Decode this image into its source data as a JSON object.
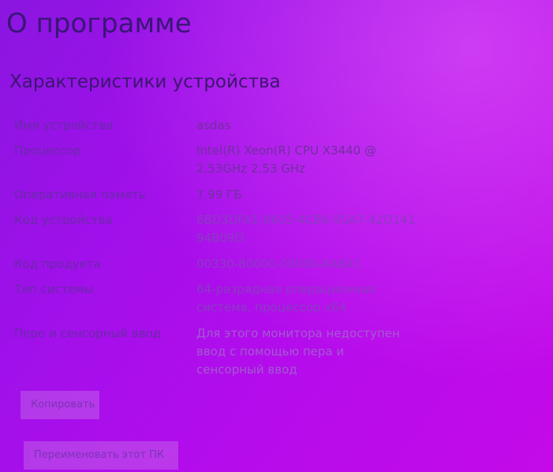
{
  "page": {
    "title": "О программе",
    "section_title": "Характеристики устройства"
  },
  "specs": [
    {
      "label": "Имя устройства",
      "value": "asdas"
    },
    {
      "label": "Процессор",
      "value": "Intel(R) Xeon(R) CPU           X3440  @\n2.53GHz   2.53 GHz"
    },
    {
      "label": "Оперативная память",
      "value": "7.99 ГБ"
    },
    {
      "label": "Код устройства",
      "value": "6BD3DFA1-8605-4CB6-95A7-42D141\n94B09D"
    },
    {
      "label": "Код продукта",
      "value": "00330-80000-00000-AAB41"
    },
    {
      "label": "Тип системы",
      "value": "64-разрядная операционная\nсистема, процессор x64"
    },
    {
      "label": "Перо и сенсорный ввод",
      "value": "Для этого монитора недоступен\nввод с помощью пера и\nсенсорный ввод"
    }
  ],
  "buttons": {
    "copy": "Копировать",
    "rename": "Переименовать этот ПК"
  }
}
